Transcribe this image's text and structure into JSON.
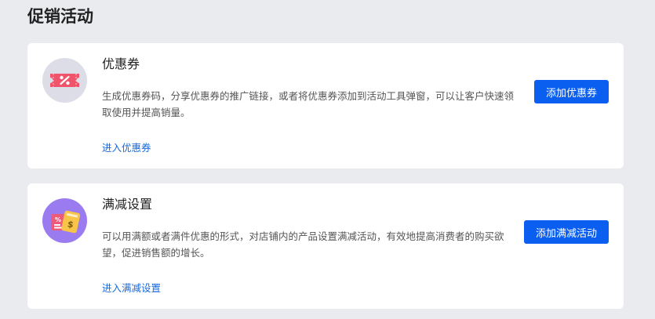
{
  "page": {
    "title": "促销活动"
  },
  "cards": [
    {
      "title": "优惠券",
      "description": "生成优惠券码，分享优惠券的推广链接，或者将优惠券添加到活动工具弹窗，可以让客户快速领取使用并提高销量。",
      "link": "进入优惠券",
      "button": "添加优惠券",
      "icon": "coupon-ticket-icon",
      "icon_bg": "#dcdde6"
    },
    {
      "title": "满减设置",
      "description": "可以用满额或者满件优惠的形式，对店铺内的产品设置满减活动，有效地提高消费者的购买欲望，促进销售额的增长。",
      "link": "进入满减设置",
      "button": "添加满减活动",
      "icon": "discount-cards-icon",
      "icon_bg": "#9b7bf0"
    }
  ],
  "colors": {
    "accent": "#0a5ef0",
    "link": "#1668dc",
    "background": "#e9ebee",
    "coupon_red": "#f0536a"
  }
}
